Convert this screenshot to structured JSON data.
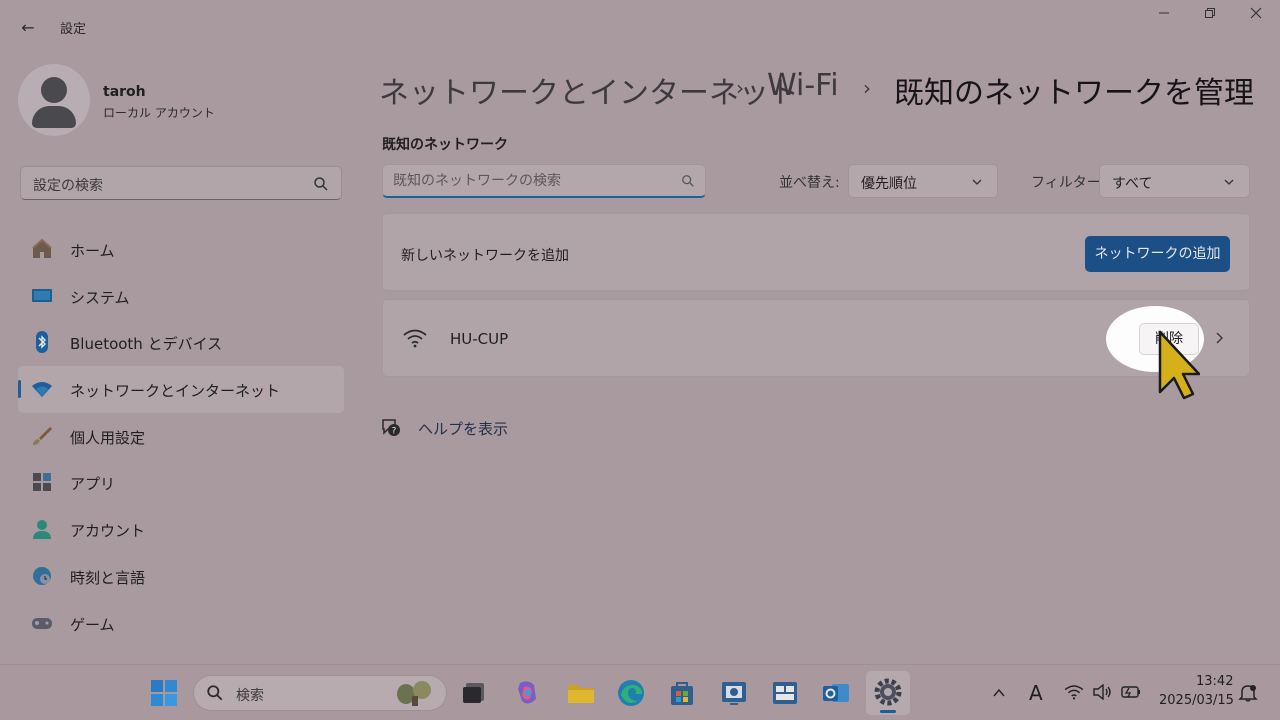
{
  "window": {
    "title": "設定",
    "back_icon": "arrow-left-icon"
  },
  "user": {
    "name": "taroh",
    "account_type": "ローカル アカウント"
  },
  "search": {
    "placeholder": "設定の検索"
  },
  "nav": {
    "items": [
      {
        "label": "ホーム",
        "icon": "home-icon"
      },
      {
        "label": "システム",
        "icon": "system-icon"
      },
      {
        "label": "Bluetooth とデバイス",
        "icon": "bluetooth-icon"
      },
      {
        "label": "ネットワークとインターネット",
        "icon": "wifi-icon",
        "selected": true
      },
      {
        "label": "個人用設定",
        "icon": "brush-icon"
      },
      {
        "label": "アプリ",
        "icon": "apps-icon"
      },
      {
        "label": "アカウント",
        "icon": "account-icon"
      },
      {
        "label": "時刻と言語",
        "icon": "globe-clock-icon"
      },
      {
        "label": "ゲーム",
        "icon": "gamepad-icon"
      }
    ]
  },
  "breadcrumb": {
    "items": [
      "ネットワークとインターネット",
      "Wi-Fi",
      "既知のネットワークを管理"
    ],
    "separator": "›"
  },
  "known_networks": {
    "section_label": "既知のネットワーク",
    "search_placeholder": "既知のネットワークの検索",
    "sort_label": "並べ替え:",
    "sort_value": "優先順位",
    "filter_label": "フィルター:",
    "filter_value": "すべて",
    "add_text": "新しいネットワークを追加",
    "add_button": "ネットワークの追加",
    "networks": [
      {
        "name": "HU-CUP",
        "delete_label": "削除"
      }
    ]
  },
  "help": {
    "label": "ヘルプを表示"
  },
  "taskbar": {
    "search_placeholder": "検索",
    "time": "13:42",
    "date": "2025/03/15",
    "ime": "A"
  },
  "colors": {
    "accent": "#1d5f9a",
    "primary_button": "#1c4f85",
    "background": "#a99aa0"
  }
}
